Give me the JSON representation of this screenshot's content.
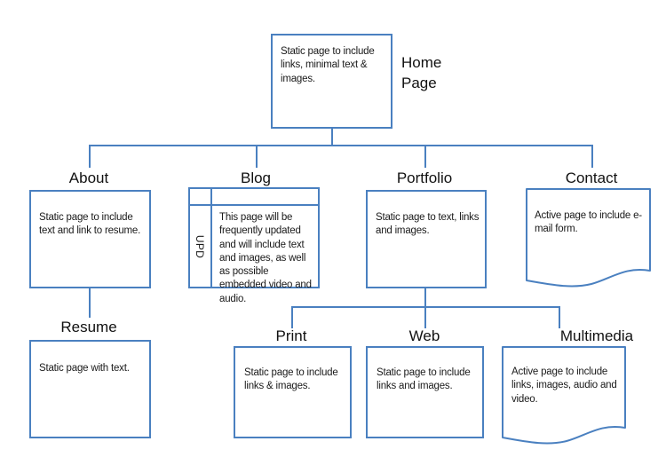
{
  "diagram": {
    "title": "Website Site Map",
    "accent_color": "#4A80C0",
    "text_color": "#1a1a1a"
  },
  "nodes": {
    "home": {
      "label": "Home\nPage",
      "body": "Static page to include links, minimal text & images.",
      "shape": "rectangle"
    },
    "about": {
      "label": "About",
      "body": "Static page to include text and link to resume.",
      "shape": "rectangle"
    },
    "blog": {
      "label": "Blog",
      "body": "This page will be frequently updated and will include text and images, as well as possible embedded video and audio.",
      "side_tag": "UPD",
      "shape": "table"
    },
    "portfolio": {
      "label": "Portfolio",
      "body": "Static page to text, links and images.",
      "shape": "rectangle"
    },
    "contact": {
      "label": "Contact",
      "body": "Active page to include e-mail form.",
      "shape": "document"
    },
    "resume": {
      "label": "Resume",
      "body": "Static page with text.",
      "shape": "rectangle"
    },
    "print": {
      "label": "Print",
      "body": "Static page to include links & images.",
      "shape": "rectangle"
    },
    "web": {
      "label": "Web",
      "body": "Static page to include links and images.",
      "shape": "rectangle"
    },
    "multimedia": {
      "label": "Multimedia",
      "body": "Active page to include links, images, audio and video.",
      "shape": "document"
    }
  },
  "connections": [
    {
      "from": "home",
      "to": "about"
    },
    {
      "from": "home",
      "to": "blog"
    },
    {
      "from": "home",
      "to": "portfolio"
    },
    {
      "from": "home",
      "to": "contact"
    },
    {
      "from": "about",
      "to": "resume"
    },
    {
      "from": "portfolio",
      "to": "print"
    },
    {
      "from": "portfolio",
      "to": "web"
    },
    {
      "from": "portfolio",
      "to": "multimedia"
    }
  ]
}
